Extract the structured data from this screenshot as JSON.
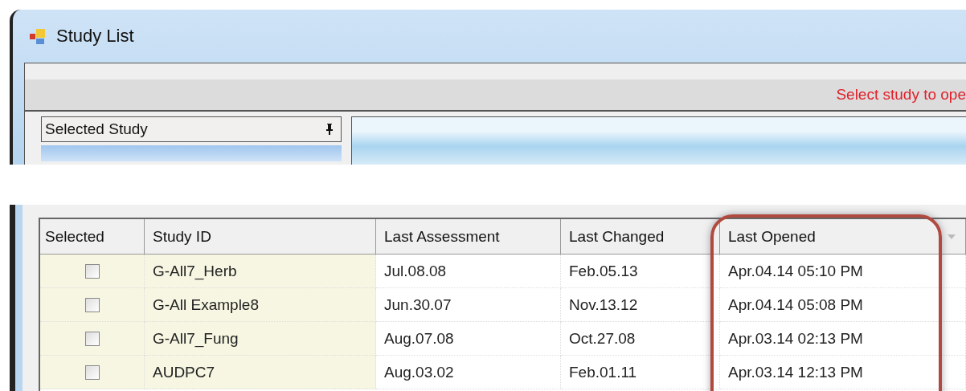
{
  "window": {
    "title": "Study List"
  },
  "message": "Select study to ope",
  "selected_study_panel": {
    "title": "Selected Study"
  },
  "table": {
    "columns": [
      {
        "label": "Selected",
        "highlighted": false,
        "sorted": false
      },
      {
        "label": "Study ID",
        "highlighted": false,
        "sorted": false
      },
      {
        "label": "Last Assessment",
        "highlighted": false,
        "sorted": false
      },
      {
        "label": "Last Changed",
        "highlighted": false,
        "sorted": false
      },
      {
        "label": "Last Opened",
        "highlighted": true,
        "sorted": true
      }
    ],
    "rows": [
      {
        "checked": false,
        "study_id": "G-All7_Herb",
        "last_assessment": "Jul.08.08",
        "last_changed": "Feb.05.13",
        "last_opened": "Apr.04.14 05:10 PM"
      },
      {
        "checked": false,
        "study_id": "G-All Example8",
        "last_assessment": "Jun.30.07",
        "last_changed": "Nov.13.12",
        "last_opened": "Apr.04.14 05:08 PM"
      },
      {
        "checked": false,
        "study_id": "G-All7_Fung",
        "last_assessment": "Aug.07.08",
        "last_changed": "Oct.27.08",
        "last_opened": "Apr.03.14 02:13 PM"
      },
      {
        "checked": false,
        "study_id": "AUDPC7",
        "last_assessment": "Aug.03.02",
        "last_changed": "Feb.01.11",
        "last_opened": "Apr.03.14 12:13 PM"
      }
    ]
  }
}
